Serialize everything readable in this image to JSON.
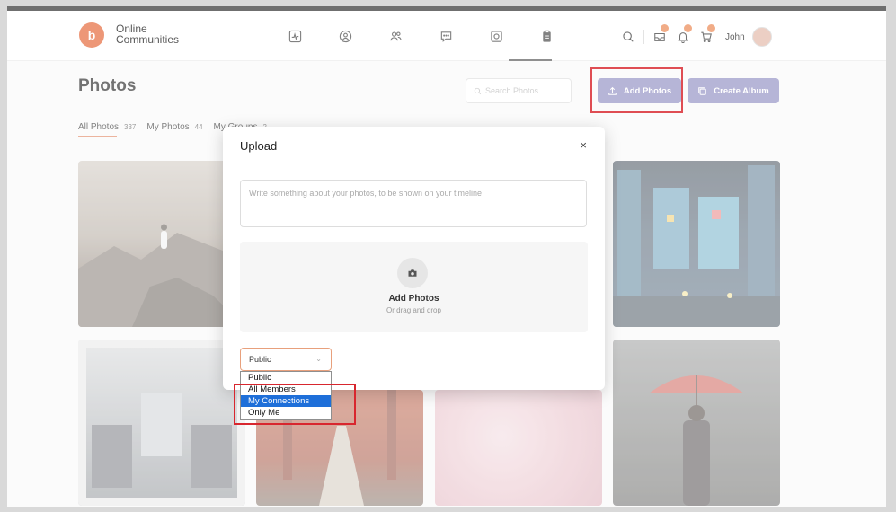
{
  "brand": {
    "logo_letter": "b",
    "name_line1": "Online",
    "name_line2": "Communities"
  },
  "header": {
    "nav_icons": [
      "activity-icon",
      "profile-icon",
      "members-icon",
      "messages-icon",
      "photos-icon",
      "documents-icon"
    ],
    "user_name": "John"
  },
  "page": {
    "title": "Photos",
    "search_placeholder": "Search Photos...",
    "add_photos_label": "Add Photos",
    "create_album_label": "Create Album",
    "tabs": [
      {
        "label": "All Photos",
        "count": "337"
      },
      {
        "label": "My Photos",
        "count": "44"
      },
      {
        "label": "My Groups",
        "count": "2"
      }
    ]
  },
  "modal": {
    "title": "Upload",
    "close": "×",
    "textarea_placeholder": "Write something about your photos, to be shown on your timeline",
    "dropzone_title": "Add Photos",
    "dropzone_subtitle": "Or drag and drop",
    "privacy_value": "Public",
    "privacy_options": [
      "Public",
      "All Members",
      "My Connections",
      "Only Me"
    ],
    "selected_option": "My Connections"
  },
  "colors": {
    "accent": "#e9805a",
    "button": "#a7a5cf",
    "highlight": "#d8262e",
    "option_selected": "#1e6fd9"
  }
}
